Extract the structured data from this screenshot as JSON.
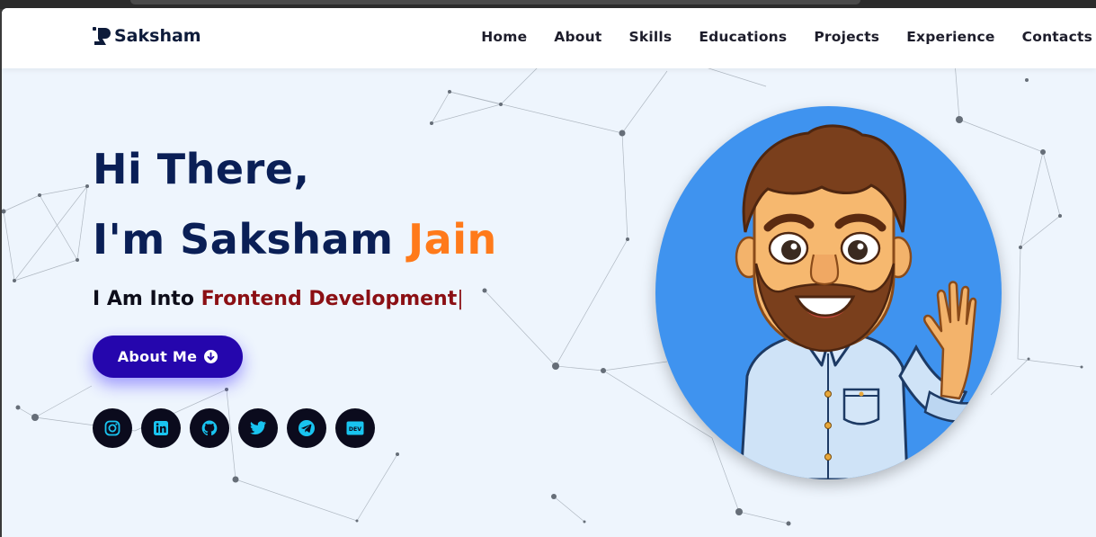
{
  "brand": {
    "name": "Saksham"
  },
  "nav": {
    "links": [
      "Home",
      "About",
      "Skills",
      "Educations",
      "Projects",
      "Experience",
      "Contacts"
    ]
  },
  "hero": {
    "greeting": "Hi There,",
    "intro_prefix": "I'm Saksham ",
    "intro_highlight": "Jain",
    "typing_prefix": "I Am Into ",
    "typing_text": "Frontend Development",
    "cursor": "|",
    "about_button": "About Me"
  },
  "socials": [
    {
      "icon": "instagram-icon"
    },
    {
      "icon": "linkedin-icon"
    },
    {
      "icon": "github-icon"
    },
    {
      "icon": "twitter-icon"
    },
    {
      "icon": "telegram-icon"
    },
    {
      "icon": "dev-icon",
      "label": "DEV"
    }
  ],
  "colors": {
    "heading": "#0a1f56",
    "accent": "#ff7a1a",
    "typed": "#8b0f14",
    "button": "#2506ad",
    "avatar_bg": "#3f93ef",
    "page_bg": "#eef5fd"
  }
}
